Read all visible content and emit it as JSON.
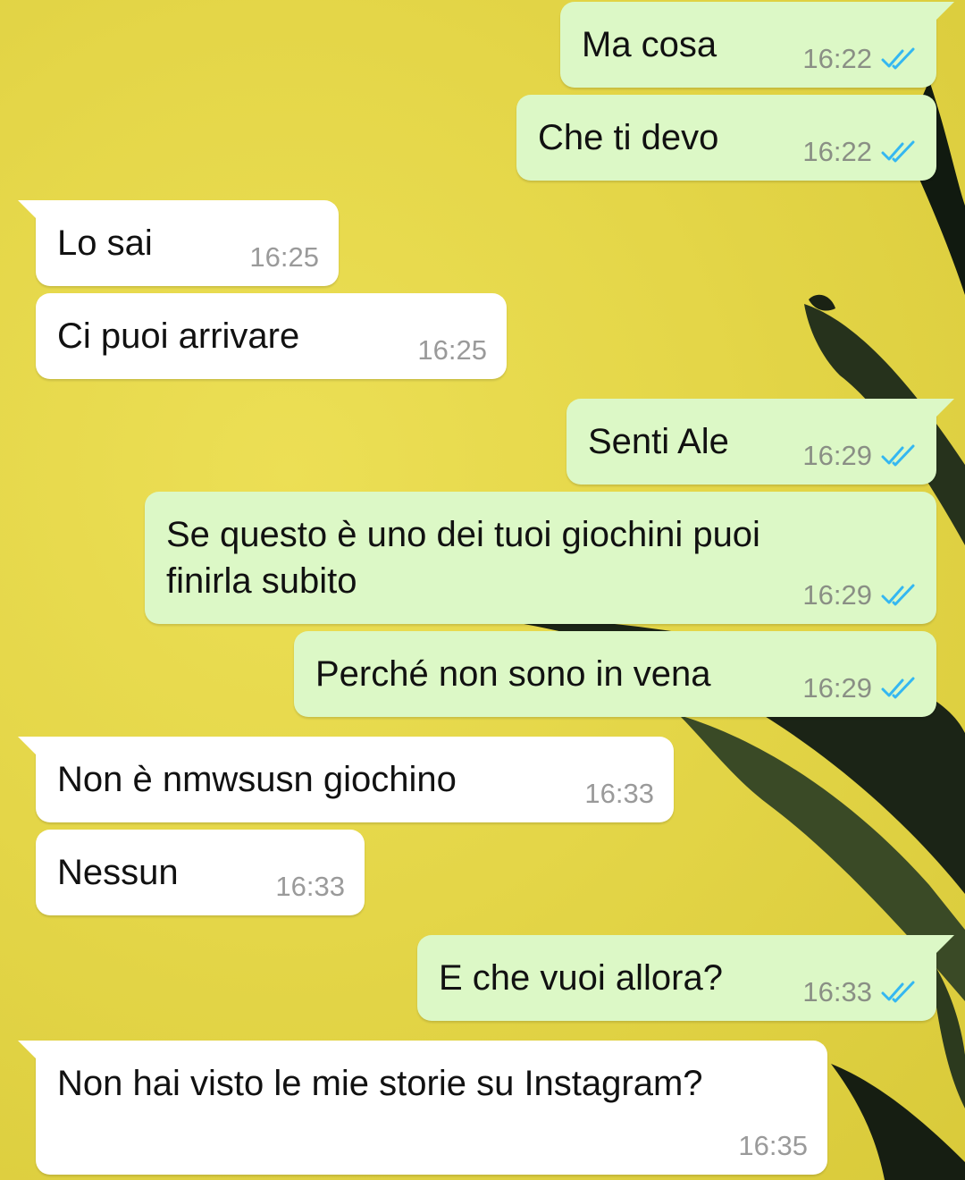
{
  "conversation": {
    "messages": [
      {
        "dir": "out",
        "text": "Ma cosa",
        "time": "16:22",
        "status_icon": "double-check-read-icon"
      },
      {
        "dir": "out",
        "text": "Che ti devo",
        "time": "16:22",
        "status_icon": "double-check-read-icon"
      },
      {
        "dir": "in",
        "text": "Lo sai",
        "time": "16:25"
      },
      {
        "dir": "in",
        "text": "Ci puoi arrivare",
        "time": "16:25"
      },
      {
        "dir": "out",
        "text": "Senti Ale",
        "time": "16:29",
        "status_icon": "double-check-read-icon"
      },
      {
        "dir": "out",
        "text": "Se questo è uno dei tuoi giochini puoi\nfinirla subito",
        "time": "16:29",
        "status_icon": "double-check-read-icon"
      },
      {
        "dir": "out",
        "text": "Perché non sono in vena",
        "time": "16:29",
        "status_icon": "double-check-read-icon"
      },
      {
        "dir": "in",
        "text": "Non è nmwsusn giochino",
        "time": "16:33"
      },
      {
        "dir": "in",
        "text": "Nessun",
        "time": "16:33"
      },
      {
        "dir": "out",
        "text": "E che vuoi allora?",
        "time": "16:33",
        "status_icon": "double-check-read-icon"
      },
      {
        "dir": "in",
        "text": "Non hai visto le mie storie su Instagram?",
        "time": "16:35"
      }
    ]
  },
  "colors": {
    "wallpaper": "#e2d442",
    "outgoing_bubble": "#dcf8c6",
    "incoming_bubble": "#ffffff",
    "read_ticks": "#34b7f1"
  }
}
